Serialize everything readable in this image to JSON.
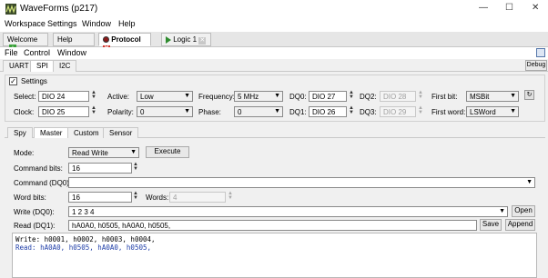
{
  "window": {
    "title": "WaveForms   (p217)",
    "minimize": "—",
    "maximize": "☐",
    "close": "✕"
  },
  "menu": [
    "Workspace",
    "Settings",
    "Window",
    "Help"
  ],
  "doc_tabs": [
    {
      "label": "Welcome"
    },
    {
      "label": "Help"
    },
    {
      "label": "Protocol"
    },
    {
      "label": "Logic 1"
    }
  ],
  "sub_menu": [
    "File",
    "Control",
    "Window"
  ],
  "protocol_tabs": [
    "UART",
    "SPI",
    "I2C"
  ],
  "debug_label": "Debug",
  "settings": {
    "title": "Settings",
    "checked": true,
    "select_label": "Select:",
    "select_value": "DIO 24",
    "clock_label": "Clock:",
    "clock_value": "DIO 25",
    "active_label": "Active:",
    "active_value": "Low",
    "polarity_label": "Polarity:",
    "polarity_value": "0",
    "frequency_label": "Frequency:",
    "frequency_value": "5 MHz",
    "phase_label": "Phase:",
    "phase_value": "0",
    "dq0_label": "DQ0:",
    "dq0_value": "DIO 27",
    "dq1_label": "DQ1:",
    "dq1_value": "DIO 26",
    "dq2_label": "DQ2:",
    "dq2_value": "DIO 28",
    "dq3_label": "DQ3:",
    "dq3_value": "DIO 29",
    "firstbit_label": "First bit:",
    "firstbit_value": "MSBit",
    "firstword_label": "First word:",
    "firstword_value": "LSWord"
  },
  "mode_tabs": [
    "Spy",
    "Master",
    "Custom",
    "Sensor"
  ],
  "master": {
    "mode_label": "Mode:",
    "mode_value": "Read Write",
    "execute_label": "Execute",
    "cmdbits_label": "Command bits:",
    "cmdbits_value": "16",
    "cmd_label": "Command (DQ0):",
    "cmd_value": "",
    "wordbits_label": "Word bits:",
    "wordbits_value": "16",
    "words_label": "Words:",
    "words_value": "4",
    "write_label": "Write (DQ0):",
    "write_value": "1 2 3 4",
    "open_label": "Open",
    "read_label": "Read (DQ1):",
    "read_value": "hA0A0, h0505, hA0A0, h0505,",
    "save_label": "Save",
    "append_label": "Append"
  },
  "console": {
    "write_line": "Write: h0001, h0002, h0003, h0004,",
    "read_line": "Read: hA0A0, h0505, hA0A0, h0505,"
  },
  "colors": {
    "accent": "#1f3ea8",
    "close_red": "#d0342c",
    "add_green": "#3aa13a",
    "play_green": "#2e8b2e"
  }
}
